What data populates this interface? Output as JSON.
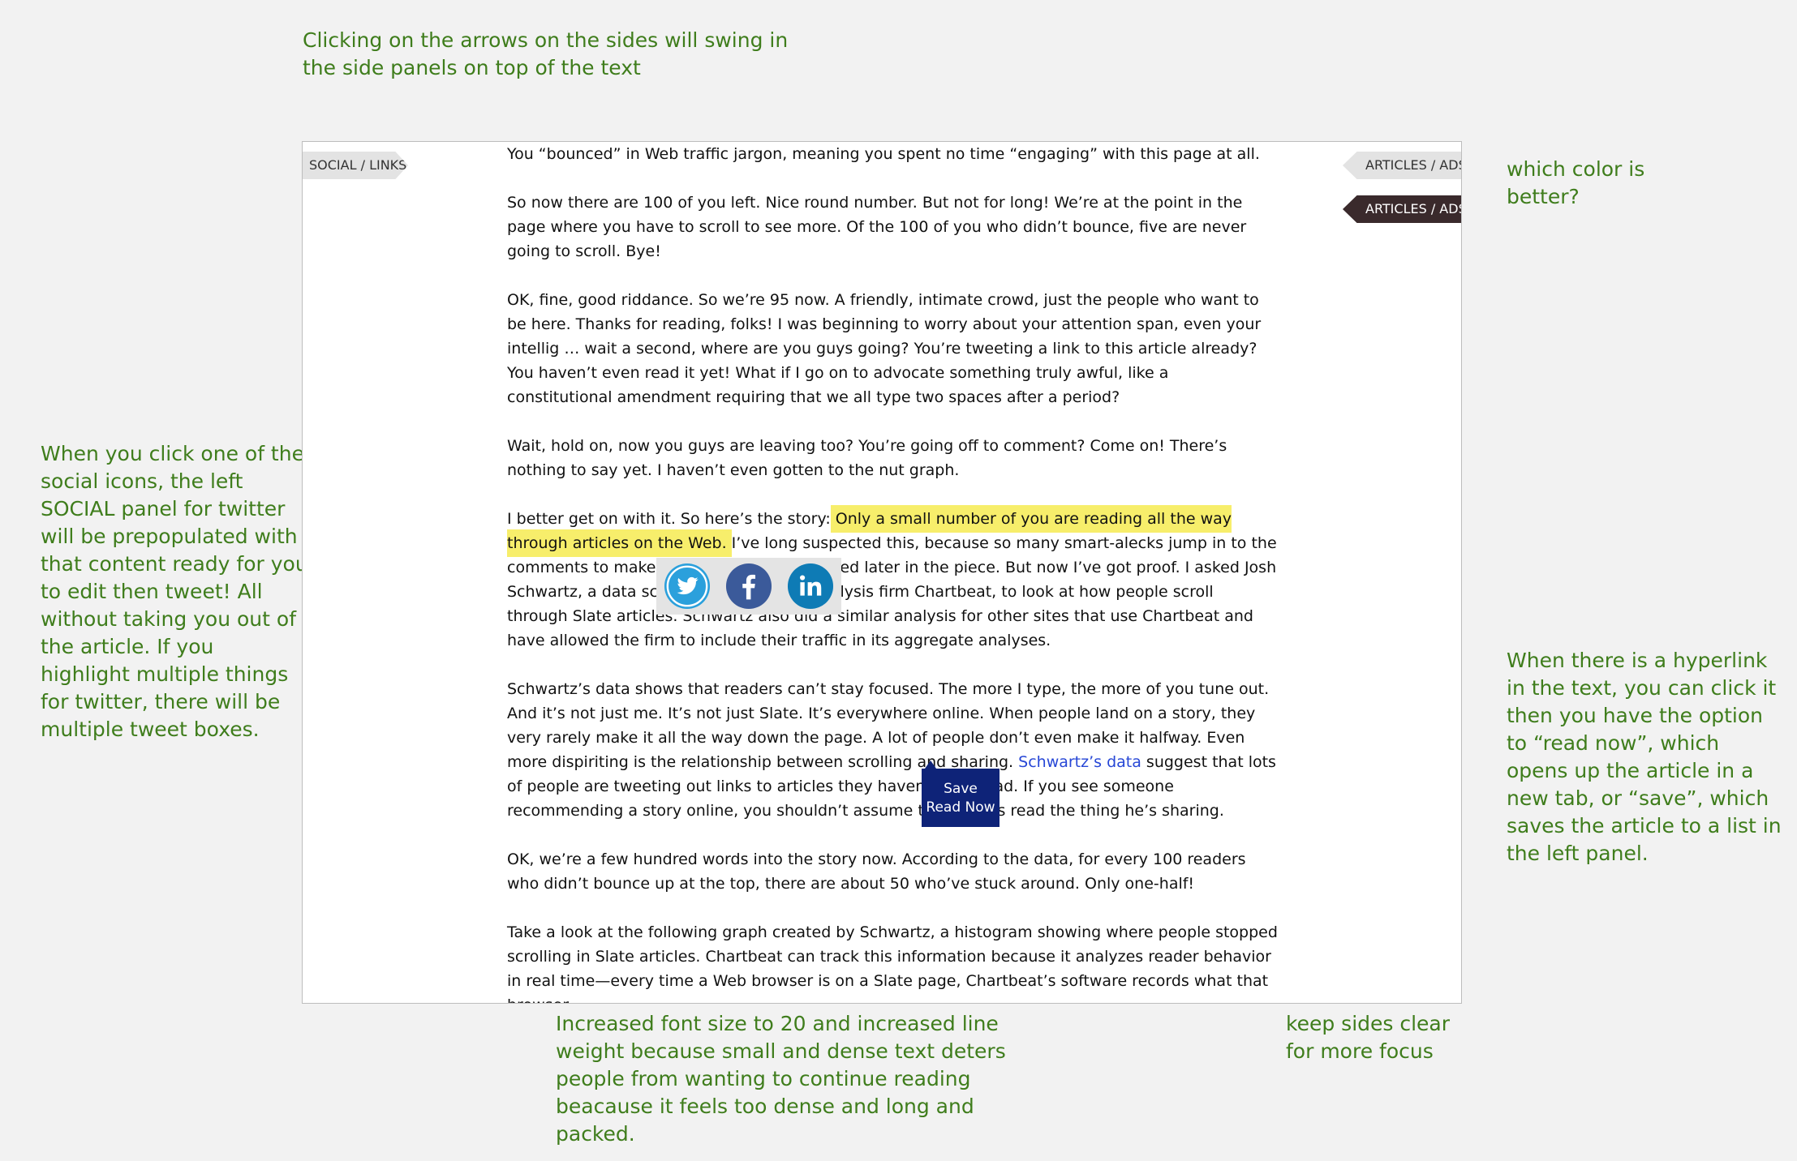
{
  "notes": {
    "top": "Clicking on the arrows on the sides will swing in the side panels on top of the text",
    "left": "When you click one of the social icons, the left SOCIAL panel for twitter will be prepopulated with that content ready for you to edit then tweet! All without taking you out of the article. If you highlight multiple things for twitter, there will be multiple tweet boxes.",
    "right_top": "which color is better?",
    "right_mid": "When there is a hyperlink in the text, you can click it then you have the option to “read now”, which opens up the article in a new tab, or “save”, which saves the article to a list in the left panel.",
    "bottom": "Increased font size to 20 and increased line weight because small and dense text deters people from wanting to continue reading beacause it feels too dense and long and packed.",
    "bottom_right": "keep sides clear for more focus"
  },
  "tabs": {
    "social": "SOCIAL / LINKS",
    "ads_light": "ARTICLES / ADS",
    "ads_dark": "ARTICLES / ADS"
  },
  "article": {
    "p1": "You “bounced” in Web traffic jargon, meaning you spent no time “engaging” with this page at all.",
    "p2": "So now there are 100 of you left. Nice round number. But not for long! We’re at the point in the page where you have to scroll to see more. Of the 100 of you who didn’t bounce, five are never going to scroll. Bye!",
    "p3": "OK, fine, good riddance. So we’re 95 now. A friendly, intimate crowd, just the people who want to be here. Thanks for reading, folks! I was beginning to worry about your attention span, even your intellig … wait a second, where are you guys going? You’re tweeting a link to this article already? You haven’t even read it yet! What if I go on to advocate something truly awful, like a constitutional amendment requiring that we all type two spaces after a period?",
    "p4": "Wait, hold on, now you guys are leaving too? You’re going off to comment? Come on! There’s nothing to say yet. I haven’t even gotten to the nut graph.",
    "p5_before": "I better get on with it. So here’s the story: ",
    "p5_highlight": "Only a small number of you are reading all the way through articles on the Web.",
    "p5_after": " I’ve long suspected this, because so many smart-alecks jump in to the comments to make points that get addressed later in the piece. But now I’ve got proof. I asked Josh Schwartz, a data scientist at the traffic analysis firm Chartbeat, to look at how people scroll through Slate articles. Schwartz also did a similar analysis for other sites that use Chartbeat and have allowed the firm to include their traffic in its aggregate analyses.",
    "p6_before": "Schwartz’s data shows that readers can’t stay focused. The more I type, the more of you tune out. And it’s not just me. It’s not just Slate. It’s everywhere online. When people land on a story, they very rarely make it all the way down the page. A lot of people don’t even make it halfway. Even more dispiriting is the relationship between scrolling and sharing. ",
    "p6_link": "Schwartz’s data",
    "p6_after": " suggest that lots of people are tweeting out links to articles they haven’t fully read. If you see someone recommending a story online, you shouldn’t assume that he has read the thing he’s sharing.",
    "p7": "OK, we’re a few hundred words into the story now. According to the data, for every 100 readers who didn’t bounce up at the top, there are about 50 who’ve stuck around. Only one-half!",
    "p8": "Take a look at the following graph created by Schwartz, a histogram showing where people stopped scrolling in Slate articles. Chartbeat can track this information because it analyzes reader behavior in real time—every time a Web browser is on a Slate page, Chartbeat’s software records what that browser"
  },
  "share": {
    "icons": [
      "twitter-icon",
      "facebook-icon",
      "linkedin-icon"
    ]
  },
  "link_popup": {
    "save": "Save",
    "read_now": "Read Now"
  },
  "colors": {
    "note_green": "#3f7d1c",
    "highlight": "#f7ee6b",
    "link_blue": "#2747d6",
    "popup_navy": "#0e2378",
    "dark_tab": "#3a2a2c",
    "twitter": "#2ba0dc",
    "facebook": "#3b5a9a",
    "linkedin": "#0e7bb5"
  }
}
